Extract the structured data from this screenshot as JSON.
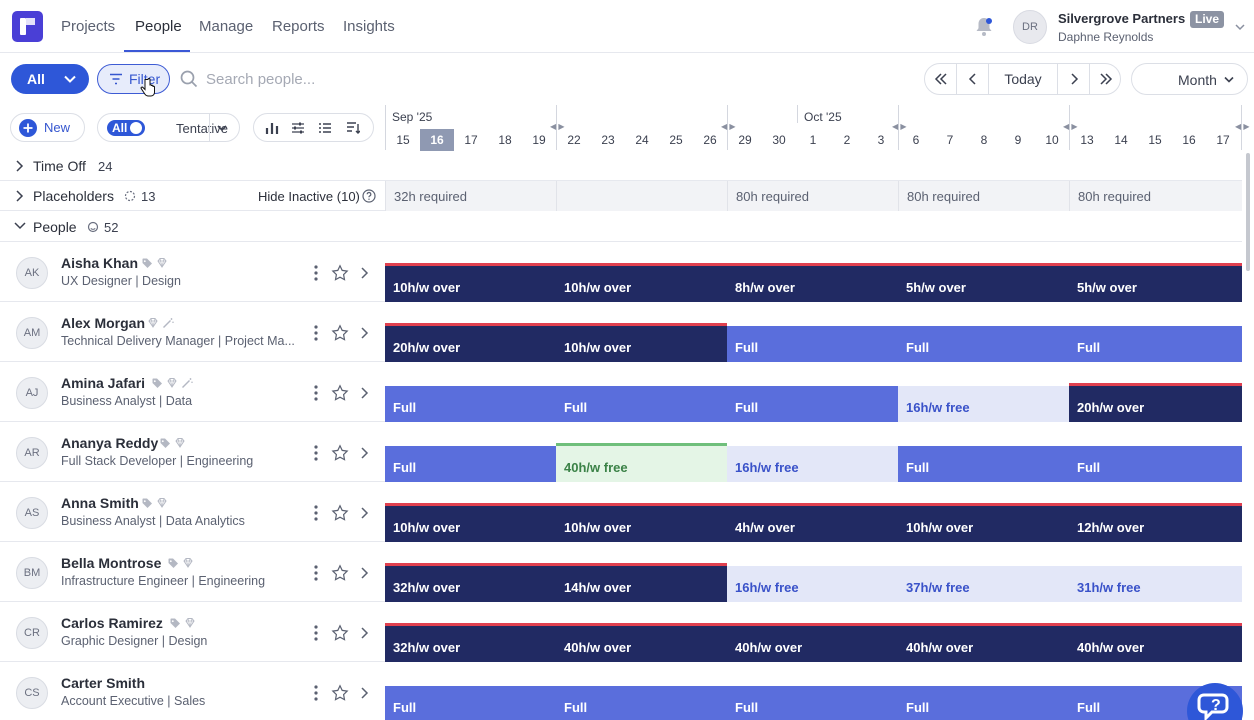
{
  "nav": {
    "tabs": [
      "Projects",
      "People",
      "Manage",
      "Reports",
      "Insights"
    ],
    "active": "People",
    "org_name": "Silvergrove Partners",
    "live_badge": "Live",
    "user_name": "Daphne Reynolds",
    "user_initials": "DR",
    "accent": "#2e57d8"
  },
  "toolbar": {
    "all_label": "All",
    "filter_label": "Filter",
    "search_placeholder": "Search people...",
    "today_label": "Today",
    "month_label": "Month"
  },
  "toolbar2": {
    "new_label": "New",
    "toggle_label": "All",
    "tentative_label": "Tentative"
  },
  "timeline": {
    "months": [
      "Sep '25",
      "Oct '25"
    ],
    "days": [
      "15",
      "16",
      "17",
      "18",
      "19",
      "22",
      "23",
      "24",
      "25",
      "26",
      "29",
      "30",
      "1",
      "2",
      "3",
      "6",
      "7",
      "8",
      "9",
      "10",
      "13",
      "14",
      "15",
      "16",
      "17"
    ],
    "today_index": 1
  },
  "groups": {
    "time_off": {
      "label": "Time Off",
      "count": "24"
    },
    "placeholders": {
      "label": "Placeholders",
      "count": "13",
      "hide_inactive": "Hide Inactive (10)"
    },
    "people": {
      "label": "People",
      "count": "52"
    },
    "placeholder_cells": [
      "32h required",
      "",
      "80h required",
      "80h required",
      "80h required"
    ]
  },
  "people": [
    {
      "initials": "AK",
      "name": "Aisha Khan",
      "role": "UX Designer | Design",
      "cells": [
        {
          "t": "10h/w over",
          "s": "over"
        },
        {
          "t": "10h/w over",
          "s": "over"
        },
        {
          "t": "8h/w over",
          "s": "over"
        },
        {
          "t": "5h/w over",
          "s": "over"
        },
        {
          "t": "5h/w over",
          "s": "over"
        }
      ]
    },
    {
      "initials": "AM",
      "name": "Alex Morgan",
      "role": "Technical Delivery Manager | Project Ma...",
      "cells": [
        {
          "t": "20h/w over",
          "s": "over"
        },
        {
          "t": "10h/w over",
          "s": "over"
        },
        {
          "t": "Full",
          "s": "full"
        },
        {
          "t": "Full",
          "s": "full"
        },
        {
          "t": "Full",
          "s": "full"
        }
      ]
    },
    {
      "initials": "AJ",
      "name": "Amina Jafari",
      "role": "Business Analyst | Data",
      "cells": [
        {
          "t": "Full",
          "s": "full"
        },
        {
          "t": "Full",
          "s": "full"
        },
        {
          "t": "Full",
          "s": "full"
        },
        {
          "t": "16h/w free",
          "s": "free"
        },
        {
          "t": "20h/w over",
          "s": "over"
        }
      ]
    },
    {
      "initials": "AR",
      "name": "Ananya Reddy",
      "role": "Full Stack Developer | Engineering",
      "cells": [
        {
          "t": "Full",
          "s": "full"
        },
        {
          "t": "40h/w free",
          "s": "vfree"
        },
        {
          "t": "16h/w free",
          "s": "free"
        },
        {
          "t": "Full",
          "s": "full"
        },
        {
          "t": "Full",
          "s": "full"
        }
      ]
    },
    {
      "initials": "AS",
      "name": "Anna Smith",
      "role": "Business Analyst | Data Analytics",
      "cells": [
        {
          "t": "10h/w over",
          "s": "over"
        },
        {
          "t": "10h/w over",
          "s": "over"
        },
        {
          "t": "4h/w over",
          "s": "over"
        },
        {
          "t": "10h/w over",
          "s": "over"
        },
        {
          "t": "12h/w over",
          "s": "over"
        }
      ]
    },
    {
      "initials": "BM",
      "name": "Bella Montrose",
      "role": "Infrastructure Engineer | Engineering",
      "cells": [
        {
          "t": "32h/w over",
          "s": "over"
        },
        {
          "t": "14h/w over",
          "s": "over"
        },
        {
          "t": "16h/w free",
          "s": "free"
        },
        {
          "t": "37h/w free",
          "s": "free"
        },
        {
          "t": "31h/w free",
          "s": "free"
        }
      ]
    },
    {
      "initials": "CR",
      "name": "Carlos Ramirez",
      "role": "Graphic Designer | Design",
      "cells": [
        {
          "t": "32h/w over",
          "s": "over"
        },
        {
          "t": "40h/w over",
          "s": "over"
        },
        {
          "t": "40h/w over",
          "s": "over"
        },
        {
          "t": "40h/w over",
          "s": "over"
        },
        {
          "t": "40h/w over",
          "s": "over"
        }
      ]
    },
    {
      "initials": "CS",
      "name": "Carter Smith",
      "role": "Account Executive | Sales",
      "cells": [
        {
          "t": "Full",
          "s": "full"
        },
        {
          "t": "Full",
          "s": "full"
        },
        {
          "t": "Full",
          "s": "full"
        },
        {
          "t": "Full",
          "s": "full"
        },
        {
          "t": "Full",
          "s": "full"
        }
      ]
    }
  ]
}
